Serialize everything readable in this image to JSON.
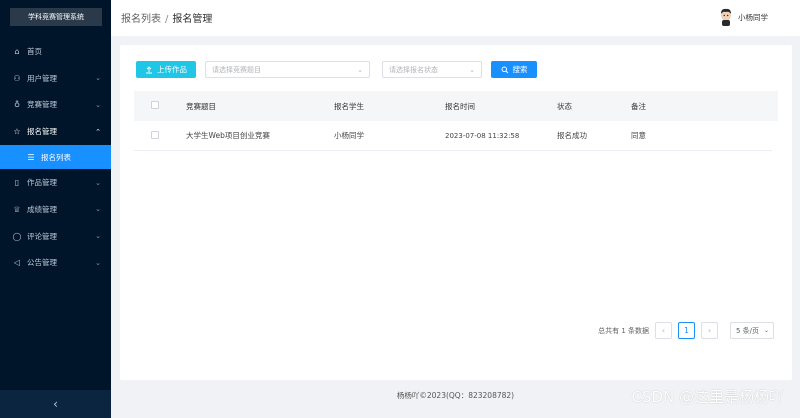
{
  "app": {
    "title": "学科竞赛管理系统"
  },
  "sidebar": {
    "items": [
      {
        "label": "首页",
        "icon": "home-icon",
        "glyph": "⌂"
      },
      {
        "label": "用户管理",
        "icon": "users-icon",
        "glyph": "⚇",
        "chev": "⌄"
      },
      {
        "label": "竞赛管理",
        "icon": "trophy-icon",
        "glyph": "♁",
        "chev": "⌄"
      },
      {
        "label": "报名管理",
        "icon": "star-icon",
        "glyph": "☆",
        "chev": "⌃"
      },
      {
        "label": "报名列表",
        "icon": "list-icon",
        "glyph": "☰"
      },
      {
        "label": "作品管理",
        "icon": "document-icon",
        "glyph": "▯",
        "chev": "⌄"
      },
      {
        "label": "成绩管理",
        "icon": "cup-icon",
        "glyph": "♕",
        "chev": "⌄"
      },
      {
        "label": "评论管理",
        "icon": "comment-icon",
        "glyph": "◯",
        "chev": "⌄"
      },
      {
        "label": "公告管理",
        "icon": "megaphone-icon",
        "glyph": "◁",
        "chev": "⌄"
      }
    ],
    "collapse_glyph": "‹"
  },
  "header": {
    "breadcrumb": [
      "报名列表",
      "报名管理"
    ],
    "separator": "/",
    "user_name": "小杨同学"
  },
  "toolbar": {
    "upload_label": "上传作品",
    "competition_placeholder": "请选择竞赛题目",
    "status_placeholder": "请选择报名状态",
    "search_label": "搜索"
  },
  "table": {
    "columns": [
      "竞赛题目",
      "报名学生",
      "报名时间",
      "状态",
      "备注"
    ],
    "rows": [
      {
        "title": "大学生Web项目创业竞赛",
        "student": "小杨同学",
        "time": "2023-07-08 11:32:58",
        "status": "报名成功",
        "note": "同意"
      }
    ]
  },
  "pagination": {
    "total_text": "总共有 1 条数据",
    "current_page": "1",
    "page_size": "5 条/页"
  },
  "footer": {
    "text": "杨杨吖©2023(QQ：823208782)"
  },
  "watermark": {
    "text": "CSDN @这里是杨杨吖"
  },
  "colors": {
    "sidebar_bg": "#001529",
    "primary": "#1890ff",
    "upload": "#1fc6e6"
  }
}
